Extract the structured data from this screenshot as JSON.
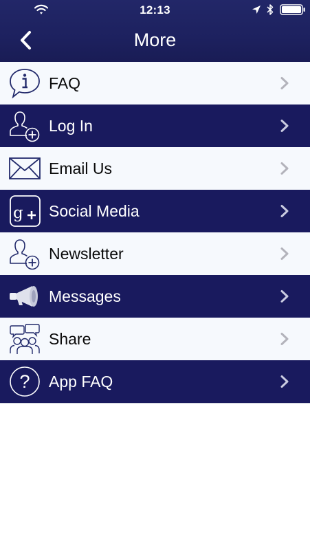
{
  "status_bar": {
    "time": "12:13",
    "icons": [
      "wifi-icon",
      "location-icon",
      "bluetooth-icon",
      "battery-icon"
    ]
  },
  "nav": {
    "title": "More",
    "back_icon": "chevron-left-icon"
  },
  "colors": {
    "header": "#1d215f",
    "dark_row": "#191a5e",
    "light_row": "#f6f9fd",
    "chevron_light": "#b3b3bb",
    "chevron_dark": "#c9cbe0"
  },
  "menu": {
    "items": [
      {
        "label": "FAQ",
        "icon": "info-bubble-icon",
        "style": "light"
      },
      {
        "label": "Log In",
        "icon": "user-add-icon",
        "style": "dark"
      },
      {
        "label": "Email Us",
        "icon": "envelope-icon",
        "style": "light"
      },
      {
        "label": "Social Media",
        "icon": "google-plus-icon",
        "style": "dark"
      },
      {
        "label": "Newsletter",
        "icon": "user-add-icon",
        "style": "light"
      },
      {
        "label": "Messages",
        "icon": "megaphone-icon",
        "style": "dark"
      },
      {
        "label": "Share",
        "icon": "people-group-icon",
        "style": "light"
      },
      {
        "label": "App FAQ",
        "icon": "question-circle-icon",
        "style": "dark"
      }
    ]
  }
}
